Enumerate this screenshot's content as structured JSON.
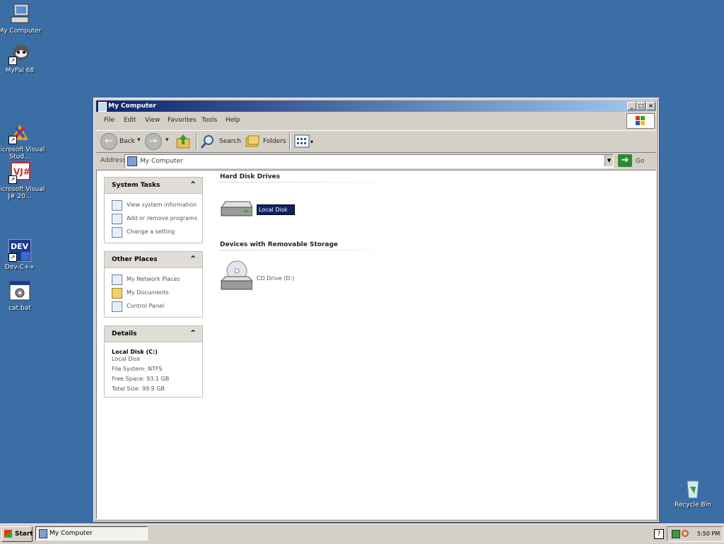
{
  "desktop": {
    "icons": [
      {
        "label": "My Computer",
        "icon": "my-computer-icon"
      },
      {
        "label": "MyPal 68",
        "icon": "mypal-browser-icon"
      },
      {
        "label": "Microsoft Visual Stud...",
        "icon": "visual-studio-icon"
      },
      {
        "label": "Microsoft Visual J# 20...",
        "icon": "visual-jsharp-icon"
      },
      {
        "label": "Dev-C++",
        "icon": "dev-cpp-icon"
      },
      {
        "label": "cat.bat",
        "icon": "batch-file-icon"
      },
      {
        "label": "Recycle Bin",
        "icon": "recycle-bin-icon"
      }
    ]
  },
  "window": {
    "title": "My Computer",
    "menu": [
      "File",
      "Edit",
      "View",
      "Favorites",
      "Tools",
      "Help"
    ],
    "toolbar": {
      "back": "Back",
      "search": "Search",
      "folders": "Folders"
    },
    "address": {
      "label": "Address",
      "value": "My Computer",
      "go": "Go"
    }
  },
  "taskpane": {
    "system_tasks": {
      "title": "System Tasks",
      "items": [
        "View system information",
        "Add or remove programs",
        "Change a setting"
      ]
    },
    "other_places": {
      "title": "Other Places",
      "items": [
        "My Network Places",
        "My Documents",
        "Control Panel"
      ]
    },
    "details": {
      "title": "Details",
      "name": "Local Disk (C:)",
      "type": "Local Disk",
      "fs": "File System: NTFS",
      "free": "Free Space: 93.1 GB",
      "total": "Total Size: 99.9 GB"
    }
  },
  "main": {
    "hard_drives_header": "Hard Disk Drives",
    "local_disk_label": "Local Disk",
    "removable_header": "Devices with Removable Storage",
    "cd_drive_label": "CD Drive (D:)"
  },
  "taskbar": {
    "start": "Start",
    "task": "My Computer",
    "clock": "5:50 PM"
  },
  "colors": {
    "desktop": "#3a6ea5",
    "titlebar_start": "#0a246a",
    "titlebar_end": "#a6caf0",
    "selection": "#0a246a"
  }
}
